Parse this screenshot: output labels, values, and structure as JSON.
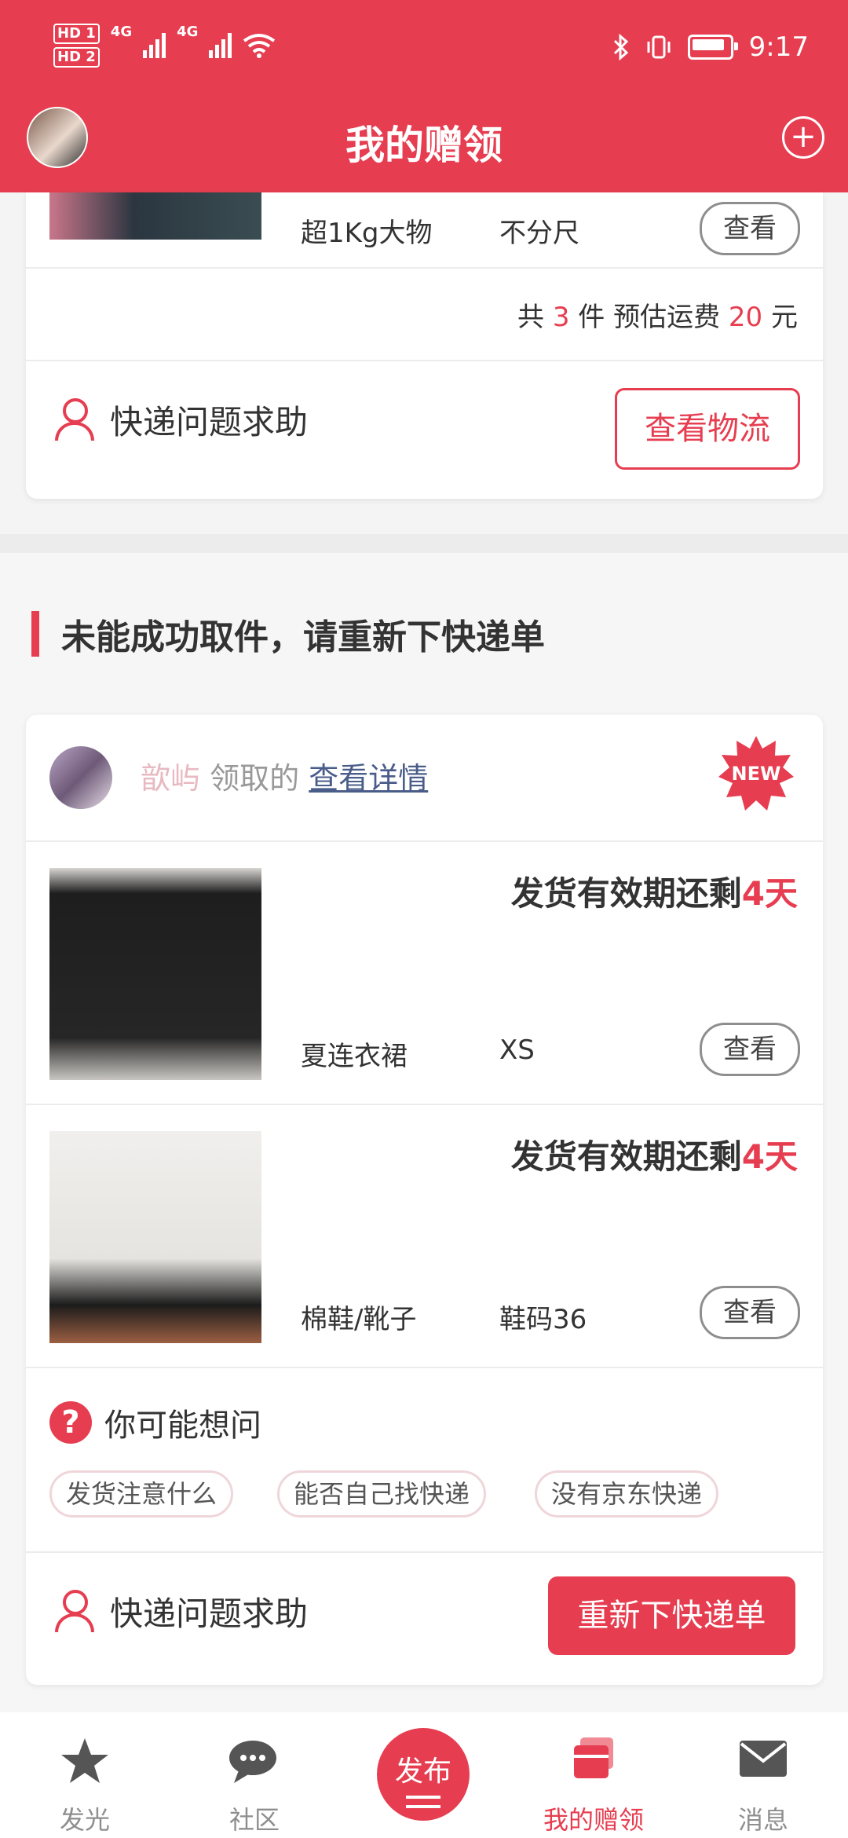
{
  "status_bar": {
    "hd1": "HD 1",
    "hd2": "HD 2",
    "net1": "4G",
    "net2": "4G",
    "time": "9:17"
  },
  "header": {
    "title": "我的赠领"
  },
  "card1": {
    "item": {
      "category": "超1Kg大物",
      "size": "不分尺",
      "view_label": "查看"
    },
    "summary": {
      "prefix": "共",
      "count": "3",
      "unit": "件 预估运费",
      "fee": "20",
      "currency": "元"
    },
    "help_label": "快递问题求助",
    "action_label": "查看物流"
  },
  "section": {
    "title": "未能成功取件，请重新下快递单"
  },
  "card2": {
    "user": {
      "name": "歆屿",
      "receive_text": "领取的",
      "details_link": "查看详情",
      "badge": "NEW"
    },
    "items": [
      {
        "deadline_prefix": "发货有效期还剩",
        "deadline_value": "4天",
        "category": "夏连衣裙",
        "size": "XS",
        "view_label": "查看"
      },
      {
        "deadline_prefix": "发货有效期还剩",
        "deadline_value": "4天",
        "category": "棉鞋/靴子",
        "size": "鞋码36",
        "view_label": "查看"
      }
    ],
    "faq": {
      "title": "你可能想问",
      "tags": [
        "发货注意什么",
        "能否自己找快递",
        "没有京东快递"
      ]
    },
    "help_label": "快递问题求助",
    "action_label": "重新下快递单"
  },
  "tabbar": {
    "items": [
      {
        "label": "发光",
        "icon": "star-icon"
      },
      {
        "label": "社区",
        "icon": "chat-icon"
      },
      {
        "label": "发布",
        "icon": "publish-icon"
      },
      {
        "label": "我的赠领",
        "icon": "gift-box-icon"
      },
      {
        "label": "消息",
        "icon": "mail-icon"
      }
    ]
  },
  "colors": {
    "accent": "#e63e50",
    "background": "#f4f4f4"
  }
}
